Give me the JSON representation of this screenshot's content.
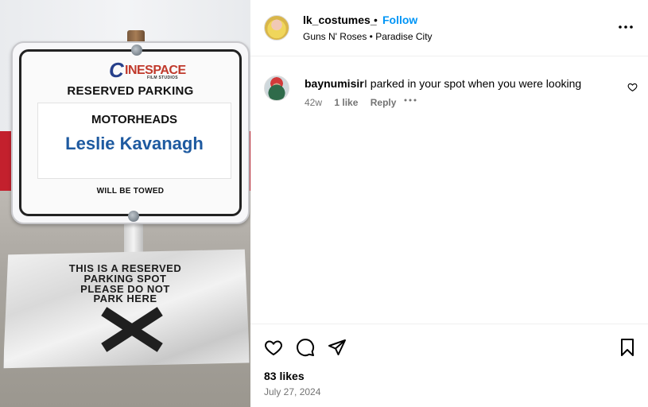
{
  "post": {
    "owner": "lk_costumes_",
    "follow_label": "Follow",
    "separator": "•",
    "audio": "Guns N' Roses • Paradise City",
    "likes": "83 likes",
    "date": "July 27, 2024"
  },
  "photo": {
    "logo_c": "C",
    "logo_word": "INESPACE",
    "logo_sub": "FILM STUDIOS",
    "sign_title": "RESERVED PARKING",
    "sign_group": "MOTORHEADS",
    "sign_name": "Leslie Kavanagh",
    "sign_footer": "WILL BE TOWED",
    "paper_lines": [
      "THIS IS A RESERVED",
      "PARKING SPOT",
      "PLEASE DO NOT",
      "PARK HERE"
    ]
  },
  "comment": {
    "user": "baynumisir",
    "text": "I parked in your spot when you were looking",
    "age": "42w",
    "likes": "1 like",
    "reply_label": "Reply"
  },
  "icons": {
    "more": "more-horizontal-icon",
    "heart": "heart-icon",
    "comment": "comment-icon",
    "share": "share-icon",
    "save": "bookmark-icon"
  },
  "colors": {
    "follow_blue": "#0095f6",
    "meta_gray": "#737373",
    "sign_name_blue": "#1e5aa0"
  }
}
